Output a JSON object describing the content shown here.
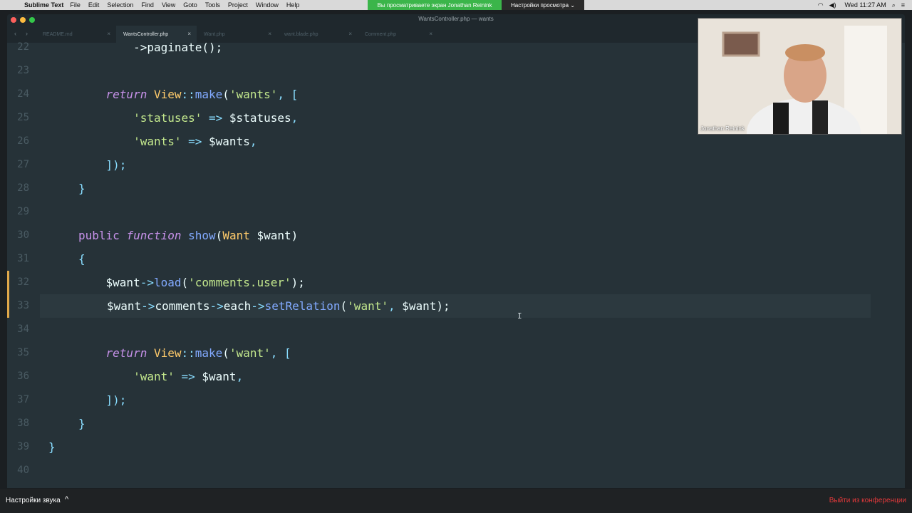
{
  "menubar": {
    "app_name": "Sublime Text",
    "menus": [
      "File",
      "Edit",
      "Selection",
      "Find",
      "View",
      "Goto",
      "Tools",
      "Project",
      "Window",
      "Help"
    ],
    "share_banner": "Вы просматриваете экран Jonathan Reinink",
    "view_settings": "Настройки просмотра ⌄",
    "clock": "Wed 11:27 AM"
  },
  "window": {
    "title": "WantsController.php — wants"
  },
  "tabs": [
    {
      "label": "README.md",
      "active": false
    },
    {
      "label": "WantsController.php",
      "active": true
    },
    {
      "label": "Want.php",
      "active": false
    },
    {
      "label": "want.blade.php",
      "active": false
    },
    {
      "label": "Comment.php",
      "active": false
    }
  ],
  "editor": {
    "lines": [
      {
        "n": "22",
        "tokens": [
          {
            "t": "        ->paginate();",
            "c": "plain"
          }
        ]
      },
      {
        "n": "23",
        "tokens": []
      },
      {
        "n": "24",
        "tokens": [
          {
            "t": "    ",
            "c": "plain"
          },
          {
            "t": "return",
            "c": "it"
          },
          {
            "t": " ",
            "c": "plain"
          },
          {
            "t": "View",
            "c": "cls"
          },
          {
            "t": "::",
            "c": "op"
          },
          {
            "t": "make",
            "c": "fn"
          },
          {
            "t": "(",
            "c": "plain"
          },
          {
            "t": "'wants'",
            "c": "str"
          },
          {
            "t": ", ",
            "c": "pun"
          },
          {
            "t": "[",
            "c": "pun"
          }
        ]
      },
      {
        "n": "25",
        "tokens": [
          {
            "t": "        ",
            "c": "plain"
          },
          {
            "t": "'statuses'",
            "c": "str"
          },
          {
            "t": " => ",
            "c": "op"
          },
          {
            "t": "$statuses",
            "c": "var"
          },
          {
            "t": ",",
            "c": "pun"
          }
        ]
      },
      {
        "n": "26",
        "tokens": [
          {
            "t": "        ",
            "c": "plain"
          },
          {
            "t": "'wants'",
            "c": "str"
          },
          {
            "t": " => ",
            "c": "op"
          },
          {
            "t": "$wants",
            "c": "var"
          },
          {
            "t": ",",
            "c": "pun"
          }
        ]
      },
      {
        "n": "27",
        "tokens": [
          {
            "t": "    ",
            "c": "plain"
          },
          {
            "t": "]);",
            "c": "pun"
          }
        ]
      },
      {
        "n": "28",
        "tokens": [
          {
            "t": "}",
            "c": "pun"
          }
        ]
      },
      {
        "n": "29",
        "tokens": []
      },
      {
        "n": "30",
        "tokens": [
          {
            "t": "public",
            "c": "kw"
          },
          {
            "t": " ",
            "c": "plain"
          },
          {
            "t": "function",
            "c": "it"
          },
          {
            "t": " ",
            "c": "plain"
          },
          {
            "t": "show",
            "c": "fn"
          },
          {
            "t": "(",
            "c": "plain"
          },
          {
            "t": "Want",
            "c": "cls"
          },
          {
            "t": " $want)",
            "c": "var"
          }
        ]
      },
      {
        "n": "31",
        "tokens": [
          {
            "t": "{",
            "c": "pun"
          }
        ]
      },
      {
        "n": "32",
        "tokens": [
          {
            "t": "    ",
            "c": "plain"
          },
          {
            "t": "$want",
            "c": "var"
          },
          {
            "t": "->",
            "c": "op"
          },
          {
            "t": "load",
            "c": "fn"
          },
          {
            "t": "(",
            "c": "plain"
          },
          {
            "t": "'comments.user'",
            "c": "str"
          },
          {
            "t": ");",
            "c": "plain"
          }
        ],
        "modified": true
      },
      {
        "n": "33",
        "tokens": [
          {
            "t": "$want",
            "c": "var"
          },
          {
            "t": "->",
            "c": "op"
          },
          {
            "t": "comments",
            "c": "plain"
          },
          {
            "t": "->",
            "c": "op"
          },
          {
            "t": "each",
            "c": "plain"
          },
          {
            "t": "->",
            "c": "op"
          },
          {
            "t": "setRelation",
            "c": "fn"
          },
          {
            "t": "(",
            "c": "plain"
          },
          {
            "t": "'want'",
            "c": "str"
          },
          {
            "t": ", ",
            "c": "pun"
          },
          {
            "t": "$want",
            "c": "var"
          },
          {
            "t": ");",
            "c": "plain"
          }
        ],
        "modified": true,
        "active": true
      },
      {
        "n": "34",
        "tokens": []
      },
      {
        "n": "35",
        "tokens": [
          {
            "t": "    ",
            "c": "plain"
          },
          {
            "t": "return",
            "c": "it"
          },
          {
            "t": " ",
            "c": "plain"
          },
          {
            "t": "View",
            "c": "cls"
          },
          {
            "t": "::",
            "c": "op"
          },
          {
            "t": "make",
            "c": "fn"
          },
          {
            "t": "(",
            "c": "plain"
          },
          {
            "t": "'want'",
            "c": "str"
          },
          {
            "t": ", ",
            "c": "pun"
          },
          {
            "t": "[",
            "c": "pun"
          }
        ]
      },
      {
        "n": "36",
        "tokens": [
          {
            "t": "        ",
            "c": "plain"
          },
          {
            "t": "'want'",
            "c": "str"
          },
          {
            "t": " => ",
            "c": "op"
          },
          {
            "t": "$want",
            "c": "var"
          },
          {
            "t": ",",
            "c": "pun"
          }
        ]
      },
      {
        "n": "37",
        "tokens": [
          {
            "t": "    ",
            "c": "plain"
          },
          {
            "t": "]);",
            "c": "pun"
          }
        ]
      },
      {
        "n": "38",
        "tokens": [
          {
            "t": "}",
            "c": "pun"
          }
        ]
      },
      {
        "n": "39",
        "tokens": [
          {
            "t": "}",
            "c": "pun"
          }
        ],
        "outer": true
      },
      {
        "n": "40",
        "tokens": []
      }
    ]
  },
  "webcam": {
    "label": "Jonathan Reinink"
  },
  "bottombar": {
    "sound_settings": "Настройки звука",
    "leave": "Выйти из конференции"
  }
}
